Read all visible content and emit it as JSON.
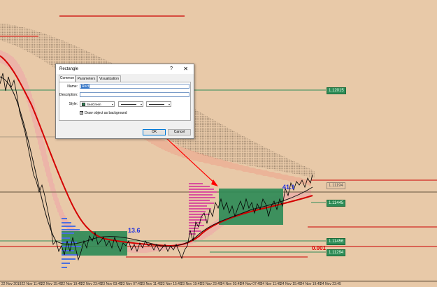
{
  "chart": {
    "colors": {
      "background": "#e8c9a8",
      "green_line": "#2e8b57",
      "red_line": "#cc0000",
      "rectangle_fill": "#2e8b57",
      "profile_pink": "#d94f9e",
      "profile_blue": "#4a6fe0",
      "ribbon_dots": "#5a4a3a",
      "ma_red": "#d40000",
      "ma_black": "#111111",
      "pink_band": "#ff69b4"
    },
    "price_tags": [
      "1.12015",
      "1.11445",
      "1.11456",
      "1.11294",
      "1.11194"
    ],
    "label_13_6": "13.6",
    "label_41_1": "41.1",
    "label_0_001": "0.001",
    "time_labels": [
      "22 Nov 2019",
      "22 Nov 11:45",
      "22 Nov 15:45",
      "22 Nov 19:45",
      "22 Nov 23:45",
      "23 Nov 03:45",
      "23 Nov 07:45",
      "23 Nov 11:45",
      "23 Nov 15:45",
      "23 Nov 19:45",
      "23 Nov 23:45",
      "24 Nov 03:45",
      "24 Nov 07:45",
      "24 Nov 11:45",
      "24 Nov 15:45",
      "24 Nov 19:45",
      "24 Nov 23:45"
    ]
  },
  "dialog": {
    "title": "Rectangle",
    "help": "?",
    "close": "✕",
    "tabs": [
      "Common",
      "Parameters",
      "Visualization"
    ],
    "name_label": "Name:",
    "name_value": "Rect",
    "description_label": "Description:",
    "description_value": "",
    "style_label": "Style:",
    "color_name": "SeaGreen",
    "color_hex": "#2e8b57",
    "checkbox_label": "Draw object as background",
    "checkbox_checked": true,
    "ok_label": "OK",
    "cancel_label": "Cancel"
  }
}
